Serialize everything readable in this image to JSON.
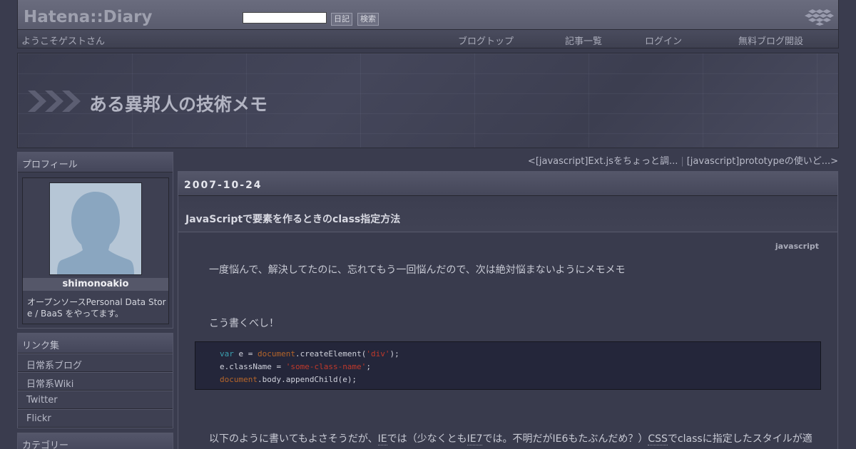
{
  "header": {
    "logo": "Hatena::Diary",
    "search_placeholder": "",
    "diary_button": "日記",
    "search_button": "検索"
  },
  "nav": {
    "welcome": "ようこそゲストさん",
    "blog_top": "ブログトップ",
    "article_list": "記事一覧",
    "login": "ログイン",
    "new_blog": "無料ブログ開設"
  },
  "banner": {
    "title": "ある異邦人の技術メモ"
  },
  "sidebar": {
    "profile_heading": "プロフィール",
    "username": "shimonoakio",
    "bio": "オープンソースPersonal Data Store / BaaS をやってます。",
    "links_heading": "リンク集",
    "links": [
      "日常系ブログ",
      "日常系Wiki",
      "Twitter",
      "Flickr"
    ],
    "category_heading": "カテゴリー"
  },
  "pager": {
    "prev": "<[javascript]Ext.jsをちょっと調...",
    "separator": "|",
    "next": "[javascript]prototypeの使いど...>"
  },
  "entry": {
    "date": "2007-10-24",
    "title": "JavaScriptで要素を作るときのclass指定方法",
    "tag": "javascript",
    "paragraph1": "一度悩んで、解決してたのに、忘れてもう一回悩んだので、次は絶対悩まないようにメモメモ",
    "paragraph2": "こう書くべし！",
    "code": {
      "l1_kw": "var",
      "l1_a": " e = ",
      "l1_obj": "document",
      "l1_b": ".createElement(",
      "l1_str": "'div'",
      "l1_c": ");",
      "l2_a": "e.className = ",
      "l2_str": "'some-class-name'",
      "l2_b": ";",
      "l3_obj": "document",
      "l3_a": ".body.appendChild(e);"
    },
    "p3": {
      "t1": "以下のように書いてもよさそうだが、",
      "ie": "IE",
      "t2": "では（少なくとも",
      "ie7": "IE7",
      "t3": "では。不明だがIE6もたぶんだめ？）",
      "css": "CSS",
      "t4": "でclassに指定したスタイルが適"
    }
  }
}
